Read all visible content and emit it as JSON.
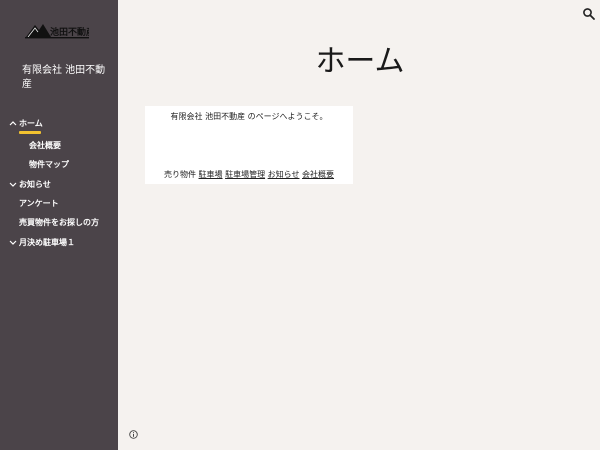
{
  "site": {
    "name": "有限会社 池田不動産",
    "logo_text": "池田不動産"
  },
  "nav": {
    "items": [
      {
        "label": "ホーム",
        "level": 0,
        "chevron": "up",
        "active": true
      },
      {
        "label": "会社概要",
        "level": 1
      },
      {
        "label": "物件マップ",
        "level": 1
      },
      {
        "label": "お知らせ",
        "level": 0,
        "chevron": "down"
      },
      {
        "label": "アンケート",
        "level": 0
      },
      {
        "label": "売買物件をお探しの方",
        "level": 0
      },
      {
        "label": "月決め駐車場１",
        "level": 0,
        "chevron": "down"
      }
    ]
  },
  "page": {
    "title": "ホーム",
    "welcome": "有限会社 池田不動産 のページへようこそ。",
    "links": [
      {
        "label": "売り物件",
        "underline": false
      },
      {
        "label": "駐車場",
        "underline": true
      },
      {
        "label": "駐車場管理",
        "underline": true
      },
      {
        "label": "お知らせ",
        "underline": true
      },
      {
        "label": "会社概要",
        "underline": true
      }
    ]
  },
  "colors": {
    "sidebar_bg": "#4b4449",
    "content_bg": "#f5f2ef",
    "active_underline": "#f2c230"
  },
  "icons": {
    "search": "search-icon",
    "info": "info-icon",
    "chevron_up": "chevron-up-icon",
    "chevron_down": "chevron-down-icon"
  }
}
